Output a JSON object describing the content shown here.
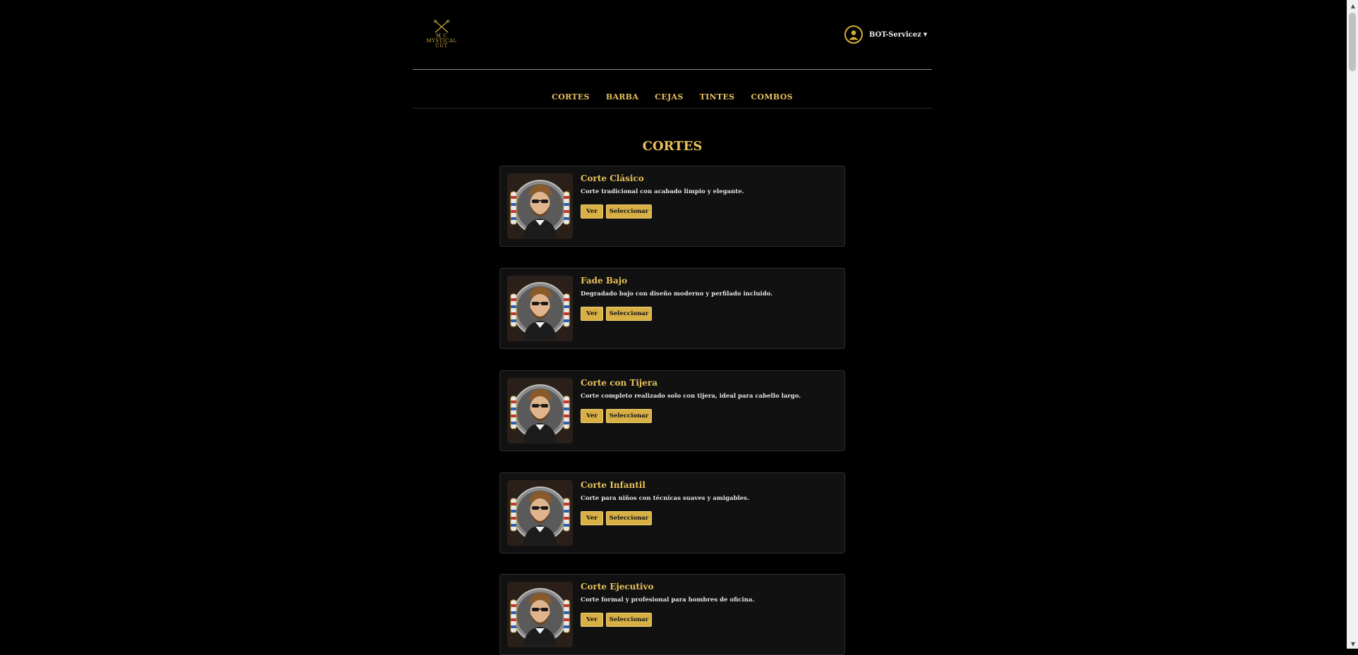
{
  "brand": {
    "logo_line1": "M C",
    "logo_line2": "MYSTICAL",
    "logo_line3": "CUT"
  },
  "user": {
    "name": "BOT-Servicez",
    "menu_icon": "caret-down-icon"
  },
  "nav": {
    "items": [
      "CORTES",
      "BARBA",
      "CEJAS",
      "TINTES",
      "COMBOS"
    ]
  },
  "section": {
    "title": "CORTES"
  },
  "services": [
    {
      "title": "Corte Clásico",
      "desc": "Corte tradicional con acabado limpio y elegante.",
      "view_label": "Ver",
      "select_label": "Seleccionar"
    },
    {
      "title": "Fade Bajo",
      "desc": "Degradado bajo con diseño moderno y perfilado incluido.",
      "view_label": "Ver",
      "select_label": "Seleccionar"
    },
    {
      "title": "Corte con Tijera",
      "desc": "Corte completo realizado solo con tijera, ideal para cabello largo.",
      "view_label": "Ver",
      "select_label": "Seleccionar"
    },
    {
      "title": "Corte Infantil",
      "desc": "Corte para niños con técnicas suaves y amigables.",
      "view_label": "Ver",
      "select_label": "Seleccionar"
    },
    {
      "title": "Corte Ejecutivo",
      "desc": "Corte formal y profesional para hombres de oficina.",
      "view_label": "Ver",
      "select_label": "Seleccionar"
    }
  ],
  "colors": {
    "accent": "#e8c15a",
    "button": "#d9b046",
    "card_bg": "#111111",
    "page_bg": "#000000"
  }
}
